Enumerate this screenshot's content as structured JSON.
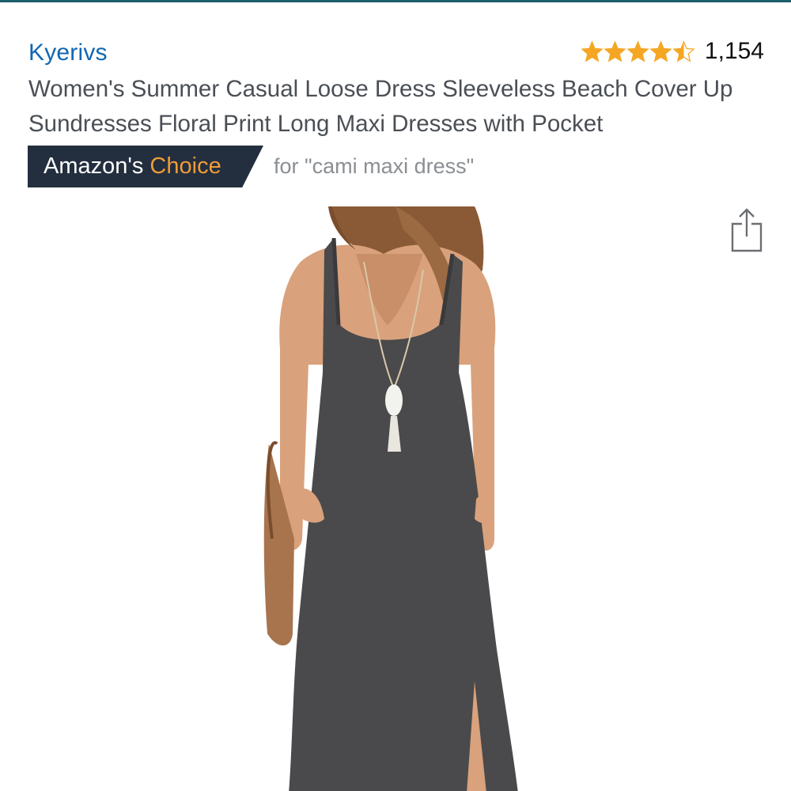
{
  "product": {
    "brand": "Kyerivs",
    "rating": {
      "stars": 4.5,
      "count": "1,154"
    },
    "title": "Women's Summer Casual Loose Dress Sleeveless Beach Cover Up Sundresses Floral Print Long Maxi Dresses with Pocket",
    "badge": {
      "prefix": "Amazon's",
      "highlight": "Choice",
      "query": "for \"cami maxi dress\""
    },
    "icons": {
      "share": "share-icon",
      "star": "star-icon"
    }
  },
  "colors": {
    "brand_link": "#1167b1",
    "star": "#f5a623",
    "badge_bg": "#232f3e",
    "badge_accent": "#f29b38",
    "dress": "#4a4a4c"
  }
}
